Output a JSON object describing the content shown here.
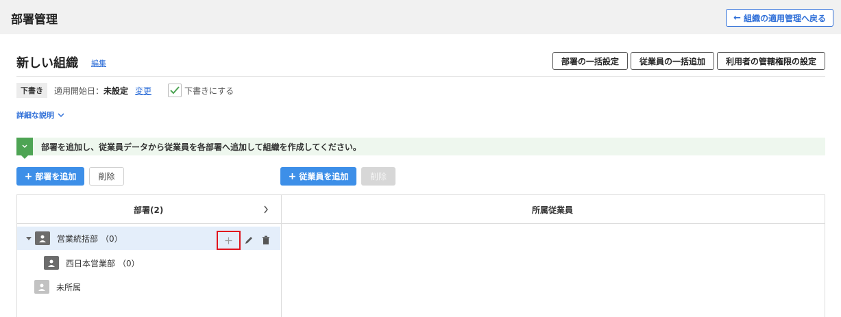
{
  "header": {
    "title": "部署管理",
    "back_label": "組織の適用管理へ戻る"
  },
  "org": {
    "name": "新しい組織",
    "edit_label": "編集",
    "actions": [
      "部署の一括設定",
      "従業員の一括追加",
      "利用者の管轄権限の設定"
    ]
  },
  "meta": {
    "status_badge": "下書き",
    "start_label": "適用開始日：",
    "start_value": "未設定",
    "change_label": "変更",
    "draft_checkbox_label": "下書きにする",
    "draft_checked": true
  },
  "details_label": "詳細な説明",
  "notice": "部署を追加し、従業員データから従業員を各部署へ追加して組織を作成してください。",
  "toolbar": {
    "add_department": "部署を追加",
    "delete_department": "削除",
    "add_employee": "従業員を追加",
    "delete_employee": "削除"
  },
  "panel": {
    "departments_header": "部署(2)",
    "employees_header": "所属従業員",
    "tree": [
      {
        "label": "営業統括部",
        "count": "（0）",
        "expanded": true,
        "selected": true
      },
      {
        "label": "西日本営業部",
        "count": "（0）"
      },
      {
        "label": "未所属",
        "count": ""
      }
    ]
  },
  "colors": {
    "accent": "#3d8fe8",
    "link": "#2f6fd8",
    "notice_bg": "#eef7ee",
    "notice_icon": "#4ea454",
    "highlight_box": "#e0141e",
    "selected_row": "#e4eefa"
  }
}
